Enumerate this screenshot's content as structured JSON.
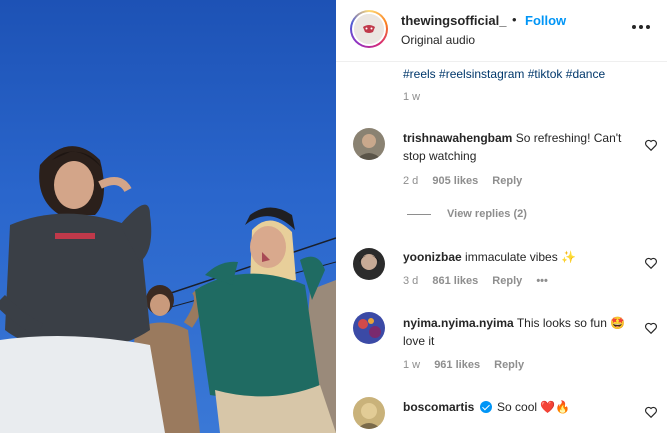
{
  "post": {
    "username": "thewingsofficial_",
    "separator": "•",
    "follow_label": "Follow",
    "audio_label": "Original audio",
    "hashtags": [
      "#reels",
      "#reelsinstagram",
      "#tiktok",
      "#dance"
    ],
    "age": "1 w",
    "more_icon": "more-horizontal-icon"
  },
  "comments": [
    {
      "username": "trishnawahengbam",
      "text": "So refreshing! Can't stop watching",
      "age": "2 d",
      "likes": "905 likes",
      "reply": "Reply",
      "view_replies": "View replies (2)"
    },
    {
      "username": "yoonizbae",
      "text": "immaculate vibes ✨",
      "age": "3 d",
      "likes": "861 likes",
      "reply": "Reply",
      "more": "•••"
    },
    {
      "username": "nyima.nyima.nyima",
      "text": "This looks so fun 🤩 love it",
      "age": "1 w",
      "likes": "961 likes",
      "reply": "Reply"
    },
    {
      "username": "boscomartis",
      "text": "So cool ❤️🔥",
      "verified": true
    }
  ],
  "colors": {
    "accent": "#0095f6",
    "hashtag": "#00376b",
    "muted": "#8e8e8e",
    "sky": "#2a66cc"
  }
}
